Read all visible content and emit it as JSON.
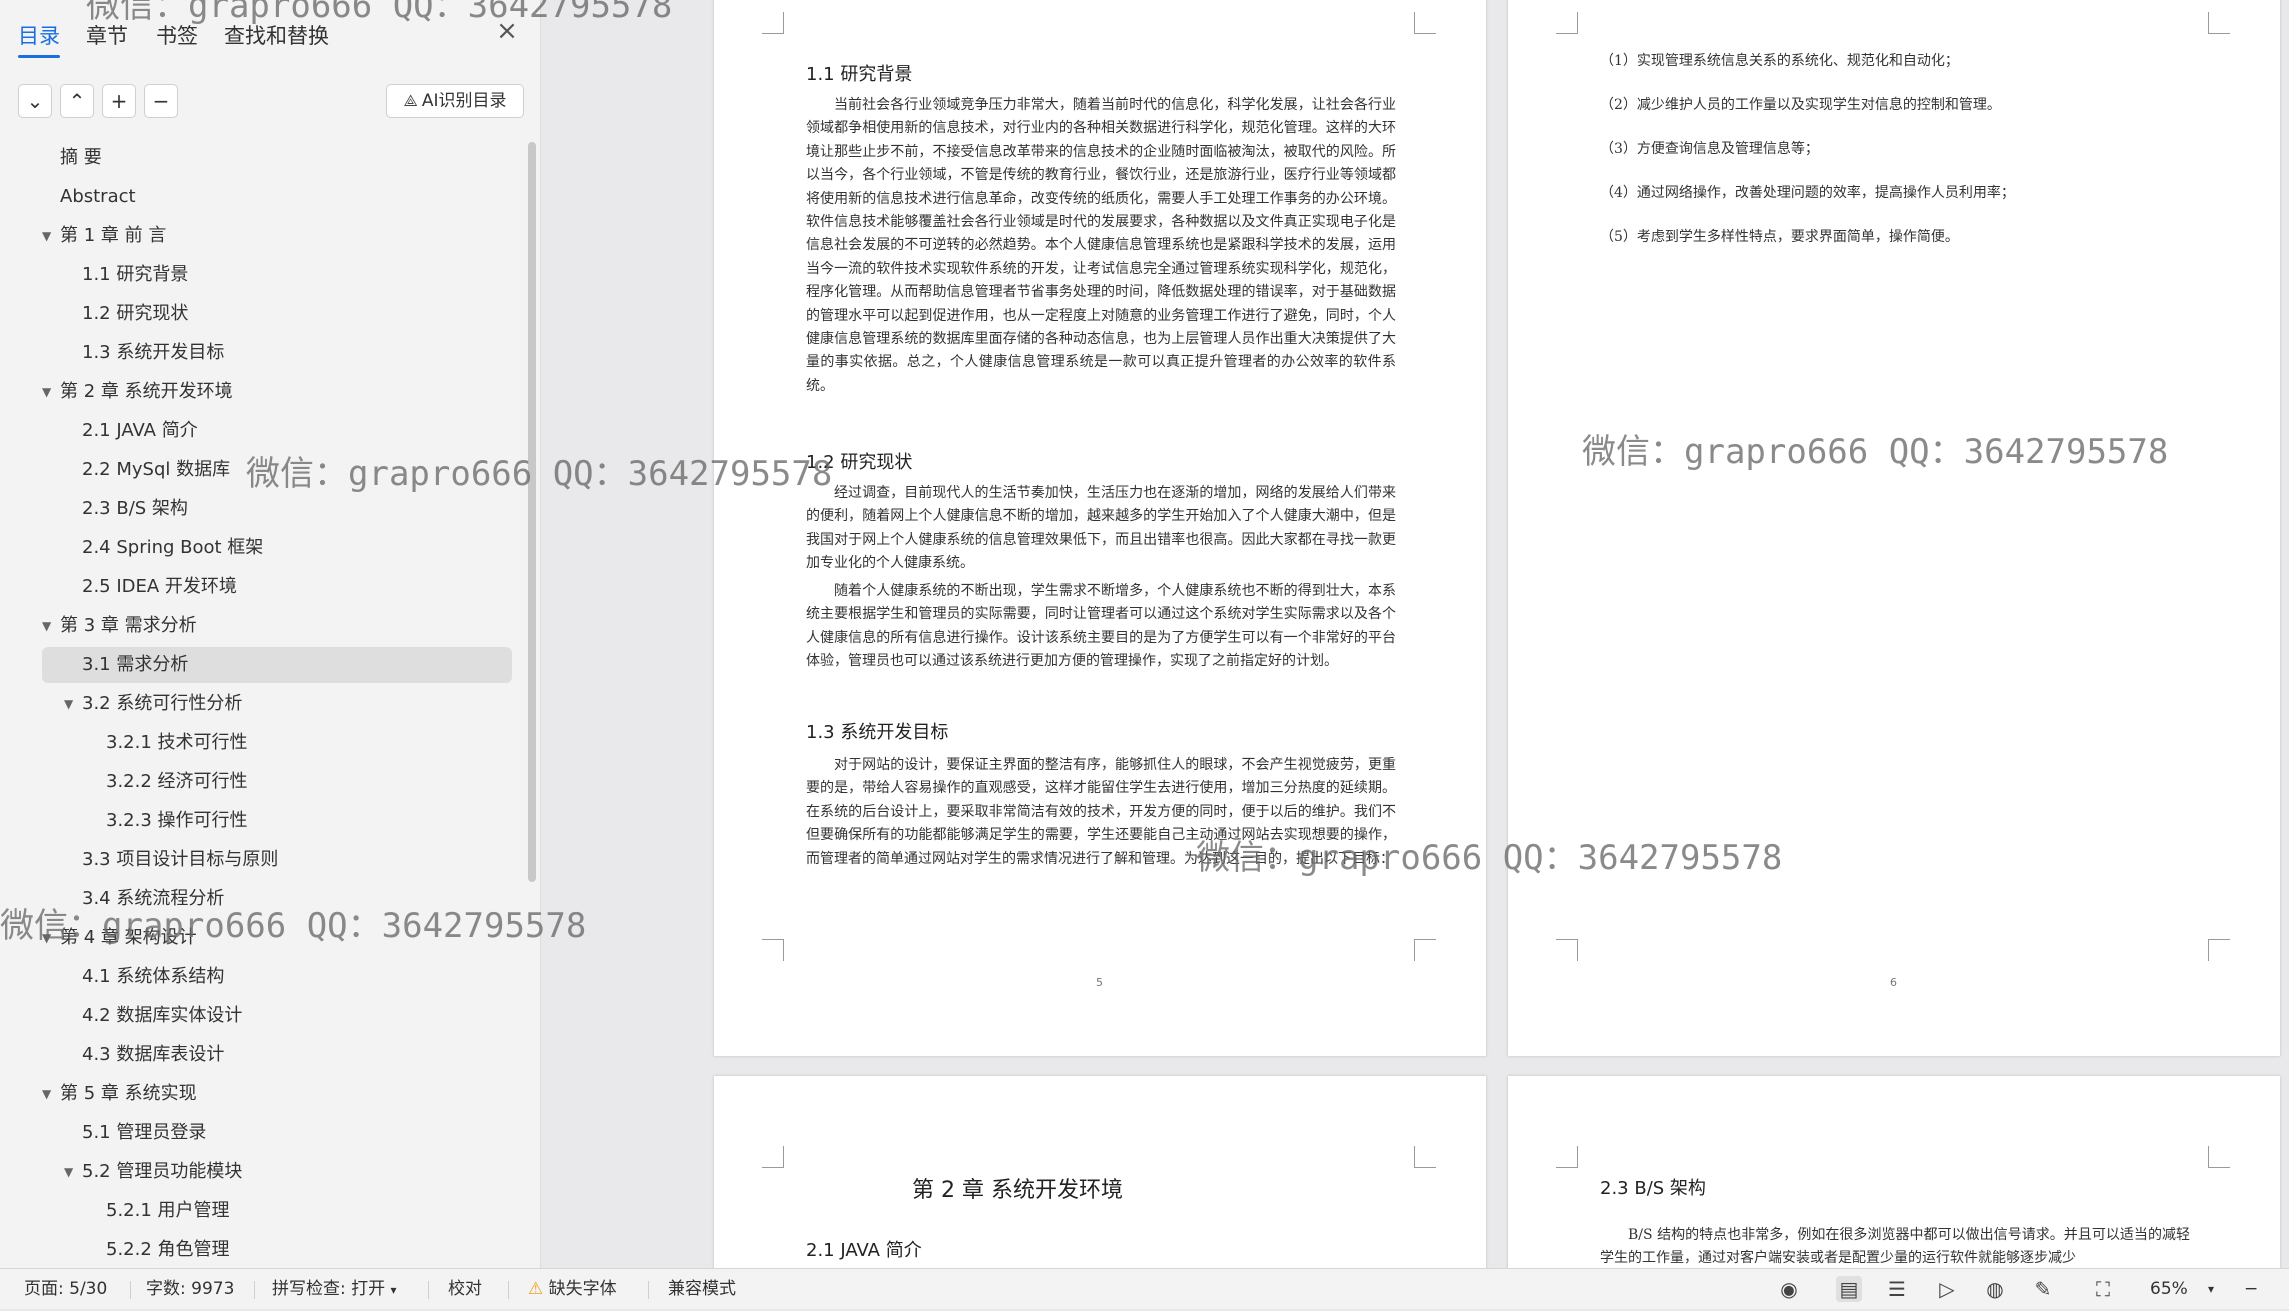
{
  "sidebar": {
    "tabs": [
      "目录",
      "章节",
      "书签",
      "查找和替换"
    ],
    "close_glyph": "×",
    "tools": {
      "collapse": "⌄",
      "expand": "⌃",
      "add": "+",
      "remove": "−",
      "ai_label": "AI识别目录"
    },
    "toc": [
      {
        "label": "摘    要",
        "level": 0,
        "caret": false
      },
      {
        "label": "Abstract",
        "level": 0,
        "caret": false
      },
      {
        "label": "第 1 章    前    言",
        "level": 0,
        "caret": true
      },
      {
        "label": "1.1    研究背景",
        "level": 1,
        "caret": false
      },
      {
        "label": "1.2    研究现状",
        "level": 1,
        "caret": false
      },
      {
        "label": "1.3    系统开发目标",
        "level": 1,
        "caret": false
      },
      {
        "label": "第 2 章    系统开发环境",
        "level": 0,
        "caret": true
      },
      {
        "label": "2.1 JAVA 简介",
        "level": 1,
        "caret": false
      },
      {
        "label": "2.2 MySql 数据库",
        "level": 1,
        "caret": false
      },
      {
        "label": "2.3 B/S 架构",
        "level": 1,
        "caret": false
      },
      {
        "label": "2.4 Spring Boot 框架",
        "level": 1,
        "caret": false
      },
      {
        "label": "2.5 IDEA 开发环境",
        "level": 1,
        "caret": false
      },
      {
        "label": "第 3 章    需求分析",
        "level": 0,
        "caret": true
      },
      {
        "label": "3.1    需求分析",
        "level": 1,
        "caret": false,
        "selected": true
      },
      {
        "label": "3.2    系统可行性分析",
        "level": 1,
        "caret": true
      },
      {
        "label": "3.2.1  技术可行性",
        "level": 2,
        "caret": false
      },
      {
        "label": "3.2.2  经济可行性",
        "level": 2,
        "caret": false
      },
      {
        "label": "3.2.3  操作可行性",
        "level": 2,
        "caret": false
      },
      {
        "label": "3.3    项目设计目标与原则",
        "level": 1,
        "caret": false
      },
      {
        "label": "3.4    系统流程分析",
        "level": 1,
        "caret": false
      },
      {
        "label": "第 4 章    架构设计",
        "level": 0,
        "caret": true
      },
      {
        "label": "4.1    系统体系结构",
        "level": 1,
        "caret": false
      },
      {
        "label": "4.2    数据库实体设计",
        "level": 1,
        "caret": false
      },
      {
        "label": "4.3    数据库表设计",
        "level": 1,
        "caret": false
      },
      {
        "label": "第 5 章    系统实现",
        "level": 0,
        "caret": true
      },
      {
        "label": "5.1 管理员登录",
        "level": 1,
        "caret": false
      },
      {
        "label": "5.2    管理员功能模块",
        "level": 1,
        "caret": true
      },
      {
        "label": "5.2.1 用户管理",
        "level": 2,
        "caret": false
      },
      {
        "label": "5.2.2 角色管理",
        "level": 2,
        "caret": false
      }
    ]
  },
  "pages": {
    "p5": {
      "h_1_1": "1.1    研究背景",
      "para_1_1": "当前社会各行业领域竞争压力非常大，随着当前时代的信息化，科学化发展，让社会各行业领域都争相使用新的信息技术，对行业内的各种相关数据进行科学化，规范化管理。这样的大环境让那些止步不前，不接受信息改革带来的信息技术的企业随时面临被淘汰，被取代的风险。所以当今，各个行业领域，不管是传统的教育行业，餐饮行业，还是旅游行业，医疗行业等领域都将使用新的信息技术进行信息革命，改变传统的纸质化，需要人手工处理工作事务的办公环境。软件信息技术能够覆盖社会各行业领域是时代的发展要求，各种数据以及文件真正实现电子化是信息社会发展的不可逆转的必然趋势。本个人健康信息管理系统也是紧跟科学技术的发展，运用当今一流的软件技术实现软件系统的开发，让考试信息完全通过管理系统实现科学化，规范化，程序化管理。从而帮助信息管理者节省事务处理的时间，降低数据处理的错误率，对于基础数据的管理水平可以起到促进作用，也从一定程度上对随意的业务管理工作进行了避免，同时，个人健康信息管理系统的数据库里面存储的各种动态信息，也为上层管理人员作出重大决策提供了大量的事实依据。总之，个人健康信息管理系统是一款可以真正提升管理者的办公效率的软件系统。",
      "h_1_2": "1.2    研究现状",
      "para_1_2a": "经过调查，目前现代人的生活节奏加快，生活压力也在逐渐的增加，网络的发展给人们带来的便利，随着网上个人健康信息不断的增加，越来越多的学生开始加入了个人健康大潮中，但是我国对于网上个人健康系统的信息管理效果低下，而且出错率也很高。因此大家都在寻找一款更加专业化的个人健康系统。",
      "para_1_2b": "随着个人健康系统的不断出现，学生需求不断增多，个人健康系统也不断的得到壮大，本系统主要根据学生和管理员的实际需要，同时让管理者可以通过这个系统对学生实际需求以及各个人健康信息的所有信息进行操作。设计该系统主要目的是为了方便学生可以有一个非常好的平台体验，管理员也可以通过该系统进行更加方便的管理操作，实现了之前指定好的计划。",
      "h_1_3": "1.3    系统开发目标",
      "para_1_3": "对于网站的设计，要保证主界面的整洁有序，能够抓住人的眼球，不会产生视觉疲劳，更重要的是，带给人容易操作的直观感受，这样才能留住学生去进行使用，增加三分热度的延续期。在系统的后台设计上，要采取非常简洁有效的技术，开发方便的同时，便于以后的维护。我们不但要确保所有的功能都能够满足学生的需要，学生还要能自己主动通过网站去实现想要的操作，而管理者的简单通过网站对学生的需求情况进行了解和管理。为达到这一目的，提出以下目标：",
      "page_num": "5"
    },
    "p6": {
      "reqs": [
        "（1）实现管理系统信息关系的系统化、规范化和自动化；",
        "（2）减少维护人员的工作量以及实现学生对信息的控制和管理。",
        "（3）方便查询信息及管理信息等；",
        "（4）通过网络操作，改善处理问题的效率，提高操作人员利用率；",
        "（5）考虑到学生多样性特点，要求界面简单，操作简便。"
      ],
      "page_num": "6"
    },
    "p7": {
      "chapter": "第 2 章    系统开发环境",
      "h_2_1": "2.1  JAVA 简介"
    },
    "p8": {
      "h_2_3": "2.3 B/S 架构",
      "para_2_3": "B/S 结构的特点也非常多，例如在很多浏览器中都可以做出信号请求。并且可以适当的减轻学生的工作量，通过对客户端安装或者是配置少量的运行软件就能够逐步减少"
    }
  },
  "watermark": "微信：grapro666 QQ：3642795578",
  "status": {
    "page": "页面: 5/30",
    "words": "字数: 9973",
    "spell": "拼写检查: 打开",
    "proof": "校对",
    "missing_font": "缺失字体",
    "compat": "兼容模式",
    "zoom": "65%"
  },
  "colors": {
    "accent": "#1a6fe0",
    "warning": "#f0a020"
  }
}
